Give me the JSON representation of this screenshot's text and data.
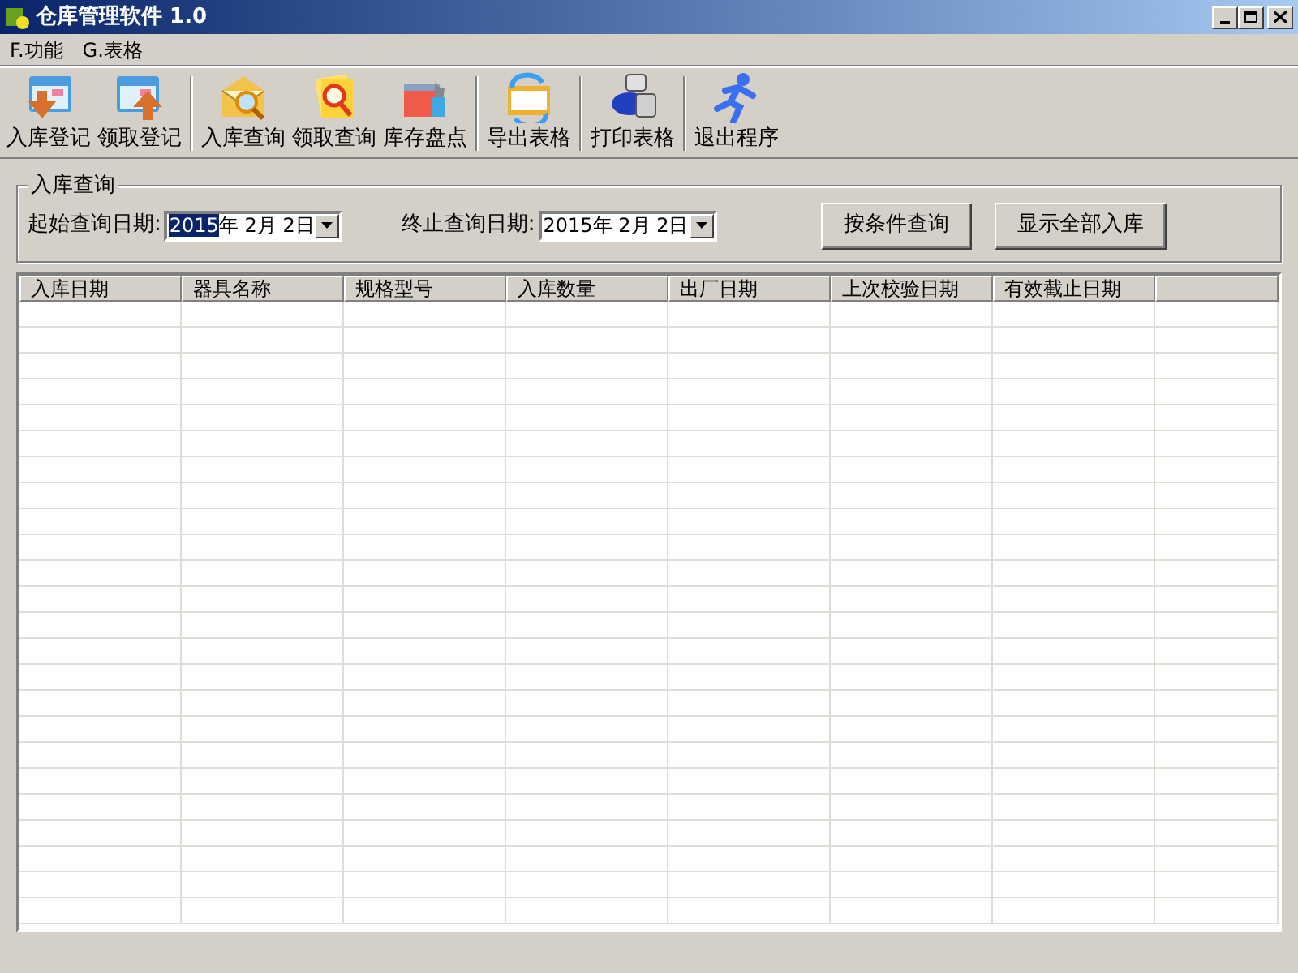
{
  "window": {
    "title": "仓库管理软件 1.0"
  },
  "menu": [
    {
      "label": "F.功能"
    },
    {
      "label": "G.表格"
    }
  ],
  "toolbar": {
    "groups": [
      [
        {
          "label": "入库登记"
        },
        {
          "label": "领取登记"
        }
      ],
      [
        {
          "label": "入库查询"
        },
        {
          "label": "领取查询"
        },
        {
          "label": "库存盘点"
        }
      ],
      [
        {
          "label": "导出表格"
        }
      ],
      [
        {
          "label": "打印表格"
        }
      ],
      [
        {
          "label": "退出程序"
        }
      ]
    ]
  },
  "query": {
    "title": "入库查询",
    "start": {
      "label": "起始查询日期:",
      "parts": [
        {
          "text": "2015",
          "selected": true
        },
        {
          "text": "年 2月 2日",
          "selected": false
        }
      ]
    },
    "end": {
      "label": "终止查询日期:",
      "parts": [
        {
          "text": "2015年 2月 2日",
          "selected": false
        }
      ]
    },
    "buttons": [
      {
        "label": "按条件查询"
      },
      {
        "label": "显示全部入库"
      }
    ]
  },
  "table": {
    "columns": [
      "入库日期",
      "器具名称",
      "规格型号",
      "入库数量",
      "出厂日期",
      "上次校验日期",
      "有效截止日期"
    ]
  }
}
